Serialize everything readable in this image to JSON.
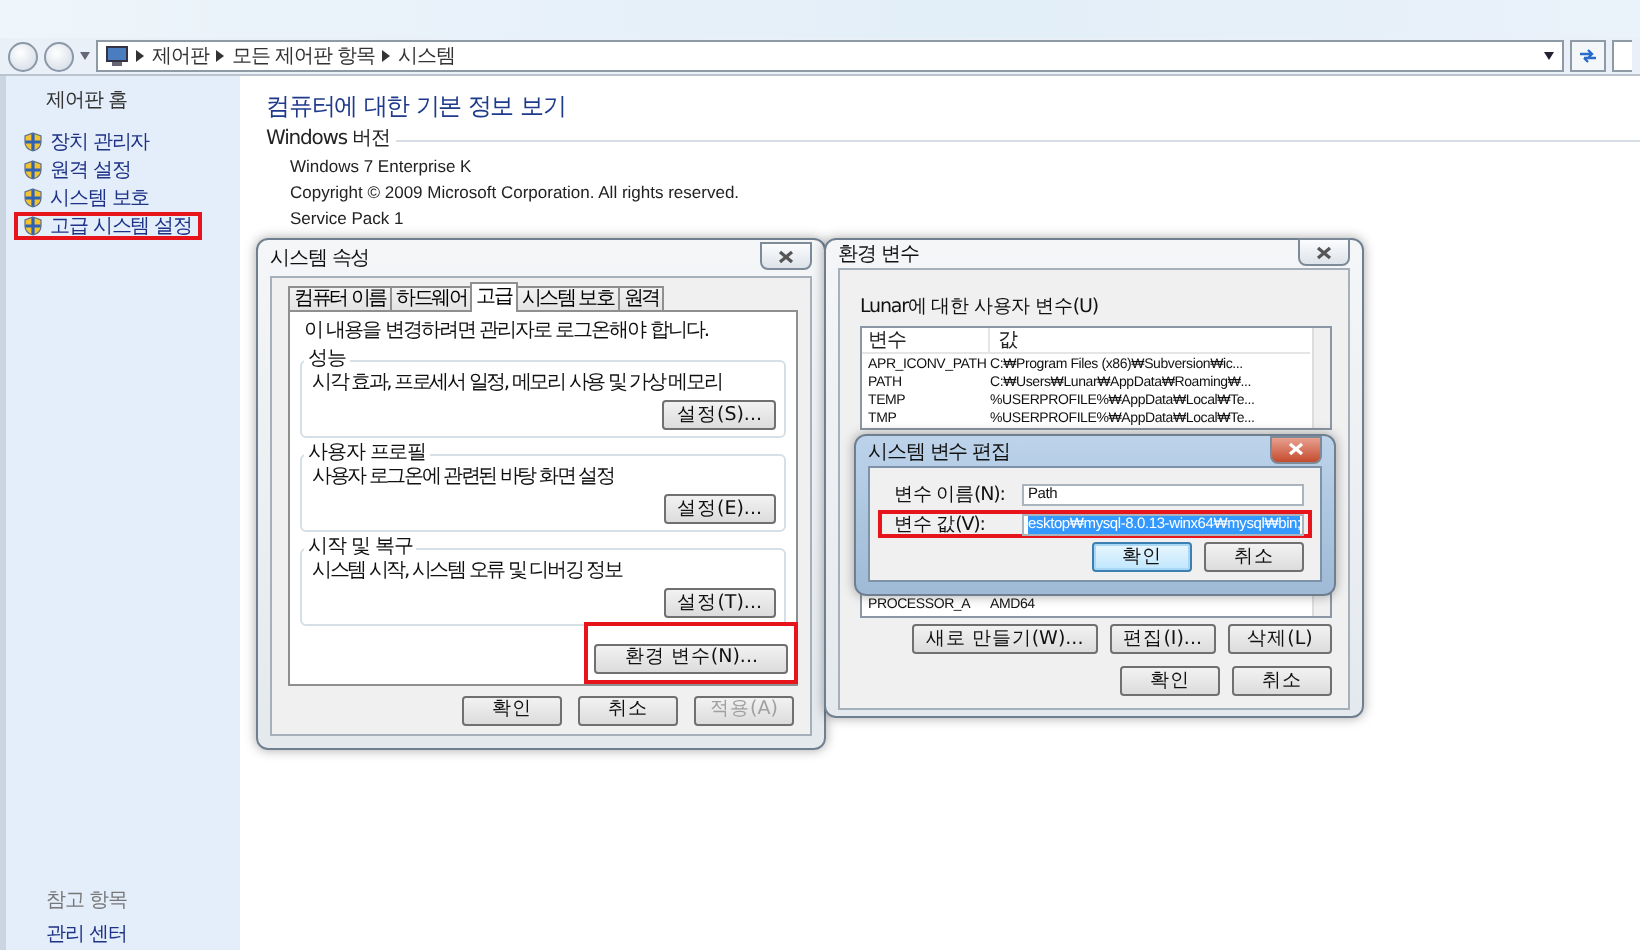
{
  "address_bar": {
    "path": [
      "제어판",
      "모든 제어판 항목",
      "시스템"
    ]
  },
  "sidebar": {
    "home": "제어판 홈",
    "items": [
      {
        "label": "장치 관리자",
        "highlighted": false
      },
      {
        "label": "원격 설정",
        "highlighted": false
      },
      {
        "label": "시스템 보호",
        "highlighted": false
      },
      {
        "label": "고급 시스템 설정",
        "highlighted": true
      }
    ],
    "see_also": {
      "heading": "참고 항목",
      "items": [
        "관리 센터"
      ]
    }
  },
  "content": {
    "title": "컴퓨터에 대한 기본 정보 보기",
    "section": "Windows 버전",
    "lines": [
      "Windows 7 Enterprise K",
      "Copyright © 2009 Microsoft Corporation. All rights reserved.",
      "Service Pack 1"
    ]
  },
  "system_properties": {
    "title": "시스템 속성",
    "tabs": [
      {
        "label": "컴퓨터 이름",
        "selected": false
      },
      {
        "label": "하드웨어",
        "selected": false
      },
      {
        "label": "고급",
        "selected": true
      },
      {
        "label": "시스템 보호",
        "selected": false
      },
      {
        "label": "원격",
        "selected": false
      }
    ],
    "notice": "이 내용을 변경하려면 관리자로 로그온해야 합니다.",
    "groups": [
      {
        "title": "성능",
        "description": "시각 효과, 프로세서 일정, 메모리 사용 및 가상 메모리",
        "button": "설정(S)..."
      },
      {
        "title": "사용자 프로필",
        "description": "사용자 로그온에 관련된 바탕 화면 설정",
        "button": "설정(E)..."
      },
      {
        "title": "시작 및 복구",
        "description": "시스템 시작, 시스템 오류 및 디버깅 정보",
        "button": "설정(T)..."
      }
    ],
    "env_button": {
      "label": "환경 변수(N)...",
      "highlighted": true
    },
    "buttons": [
      {
        "label": "확인",
        "disabled": false
      },
      {
        "label": "취소",
        "disabled": false
      },
      {
        "label": "적용(A)",
        "disabled": true
      }
    ]
  },
  "environment_variables": {
    "title": "환경 변수",
    "user_label": "Lunar에 대한 사용자 변수(U)",
    "columns": [
      "변수",
      "값"
    ],
    "user_rows": [
      {
        "name": "APR_ICONV_PATH",
        "value": "C:₩Program Files (x86)₩Subversion₩ic..."
      },
      {
        "name": "PATH",
        "value": "C:₩Users₩Lunar₩AppData₩Roaming₩..."
      },
      {
        "name": "TEMP",
        "value": "%USERPROFILE%₩AppData₩Local₩Te..."
      },
      {
        "name": "TMP",
        "value": "%USERPROFILE%₩AppData₩Local₩Te..."
      }
    ],
    "system_rows": [
      {
        "name": "PROCESSOR_A",
        "value": "AMD64"
      }
    ],
    "system_buttons": [
      "새로 만들기(W)...",
      "편집(I)...",
      "삭제(L)"
    ],
    "buttons": [
      "확인",
      "취소"
    ]
  },
  "edit_dialog": {
    "title": "시스템 변수 편집",
    "name_label": "변수 이름(N):",
    "name_value": "Path",
    "value_label": "변수 값(V):",
    "value_value": "esktop₩mysql-8.0.13-winx64₩mysql₩bin;",
    "value_selected": true,
    "value_highlighted": true,
    "buttons": [
      {
        "label": "확인",
        "default": true
      },
      {
        "label": "취소",
        "default": false
      }
    ]
  }
}
